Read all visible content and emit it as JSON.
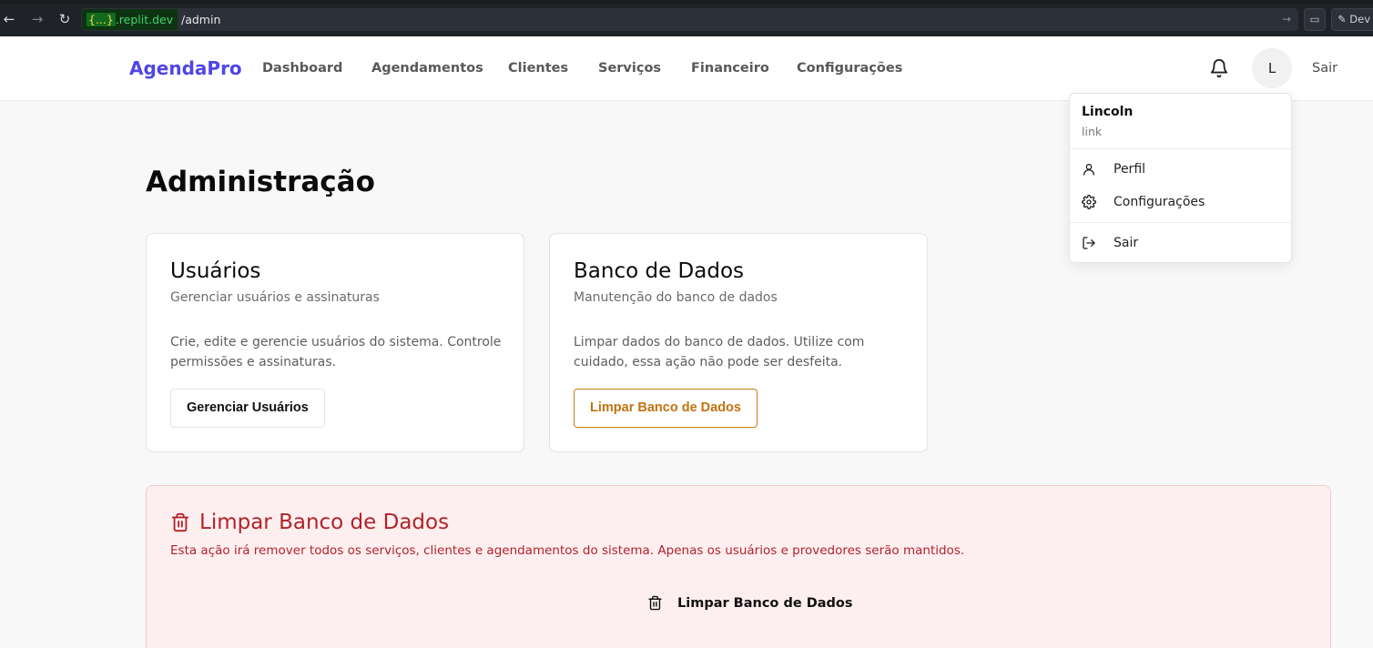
{
  "browser": {
    "host_braces": "{...}",
    "host_domain": ".replit.dev",
    "path": "/admin",
    "dev_label": "Dev"
  },
  "header": {
    "brand": "AgendaPro",
    "nav": [
      "Dashboard",
      "Agendamentos",
      "Clientes",
      "Serviços",
      "Financeiro",
      "Configurações"
    ],
    "avatar_initial": "L",
    "logout_label": "Sair"
  },
  "main": {
    "title": "Administração",
    "cards": [
      {
        "title": "Usuários",
        "subtitle": "Gerenciar usuários e assinaturas",
        "description": "Crie, edite e gerencie usuários do sistema. Controle permissões e assinaturas.",
        "button": "Gerenciar Usuários"
      },
      {
        "title": "Banco de Dados",
        "subtitle": "Manutenção do banco de dados",
        "description": "Limpar dados do banco de dados. Utilize com cuidado, essa ação não pode ser desfeita.",
        "button": "Limpar Banco de Dados"
      }
    ],
    "danger": {
      "title": "Limpar Banco de Dados",
      "text": "Esta ação irá remover todos os serviços, clientes e agendamentos do sistema. Apenas os usuários e provedores serão mantidos.",
      "button": "Limpar Banco de Dados"
    }
  },
  "user_menu": {
    "name": "Lincoln",
    "username": "link",
    "items": [
      "Perfil",
      "Configurações",
      "Sair"
    ]
  },
  "colors": {
    "brand": "#4f46e5",
    "danger_text": "#b3222a",
    "danger_bg": "#fdeff0",
    "warning_button": "#c27311"
  }
}
